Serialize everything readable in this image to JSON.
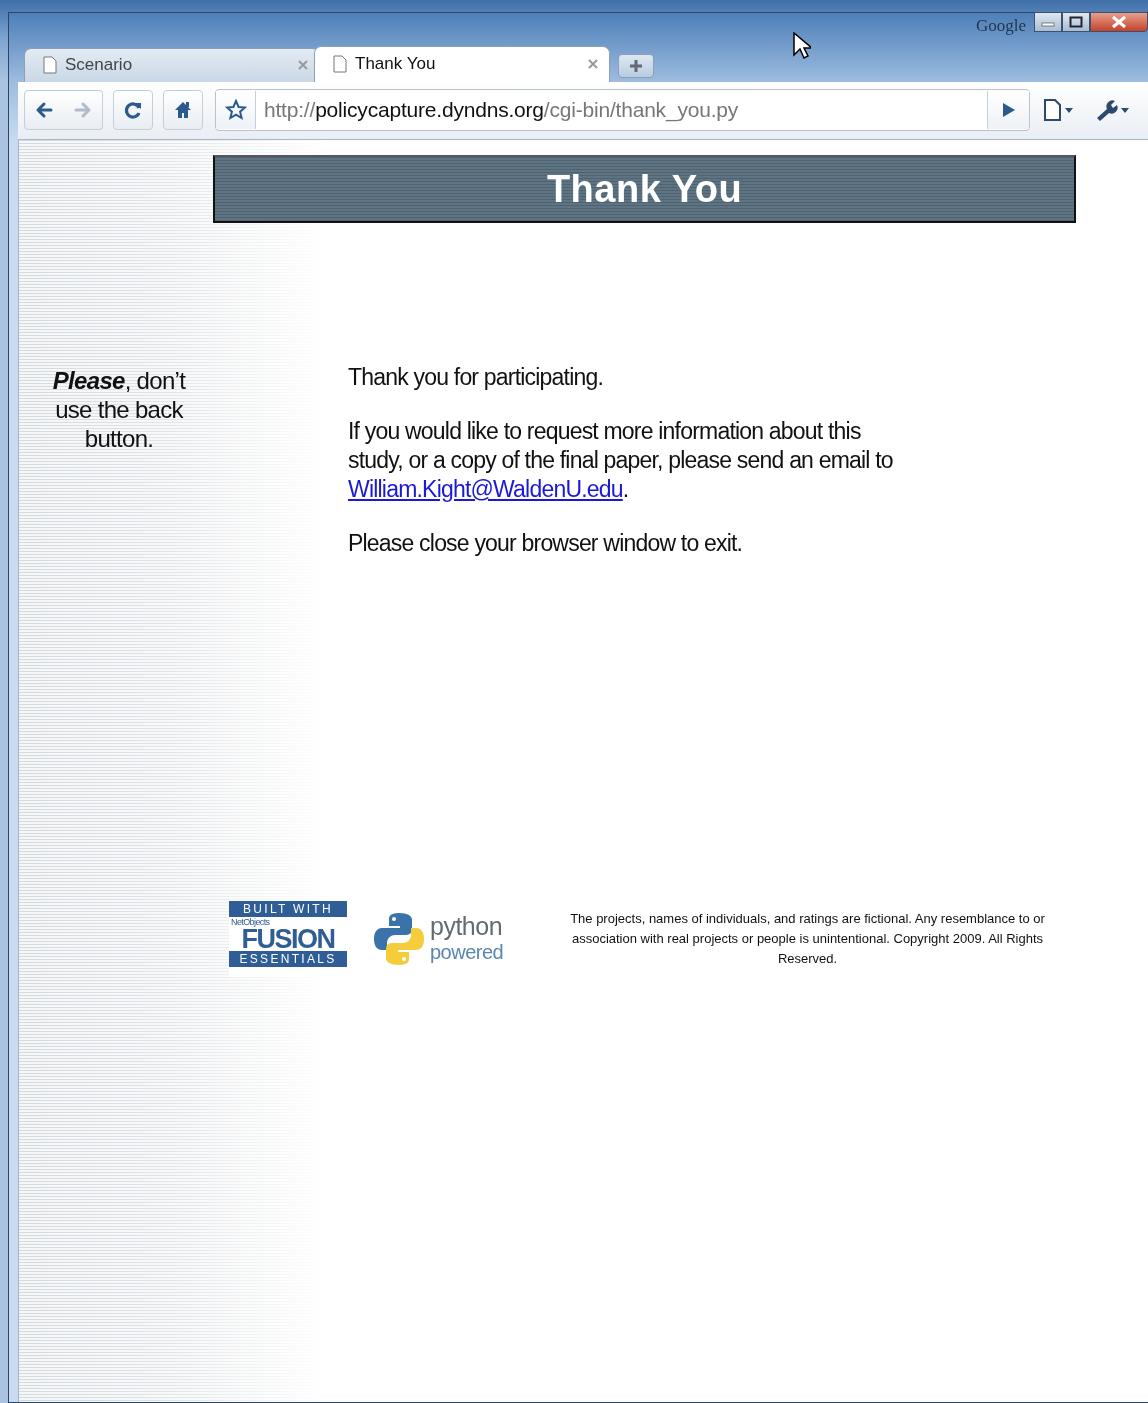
{
  "window": {
    "title_label": "Google"
  },
  "tabs": [
    {
      "label": "Scenario",
      "selected": false
    },
    {
      "label": "Thank You",
      "selected": true
    }
  ],
  "toolbar": {
    "nav_buttons": [
      {
        "kind": "back",
        "disabled": false
      },
      {
        "kind": "forward",
        "disabled": true
      },
      {
        "kind": "reload",
        "disabled": false
      },
      {
        "kind": "home",
        "disabled": false
      }
    ],
    "address": {
      "scheme": "http://",
      "host": "policycapture.dyndns.org",
      "path": "/cgi-bin/thank_you.py"
    }
  },
  "page": {
    "heading": "Thank You",
    "side_note": "**Please**, don’t use the back button.",
    "paragraphs": [
      {
        "text": "Thank you for participating."
      },
      {
        "text": "If you would like to request more information about this study, or a copy of the final paper, please send an email to ",
        "link": "William.Kight@WaldenU.edu",
        "after": "."
      },
      {
        "text": "Please close your browser window to exit."
      }
    ],
    "footer": {
      "fusion_badge": {
        "top": "BUILT WITH",
        "maker": "NetObjects",
        "name": "FUSION",
        "bottom": "ESSENTIALS"
      },
      "python_badge": {
        "name": "python",
        "sub": "powered"
      },
      "disclaimer": "The projects, names of individuals, and ratings are fictional. Any resemblance to or association with real projects or people is unintentional. Copyright 2009. All Rights Reserved."
    }
  }
}
